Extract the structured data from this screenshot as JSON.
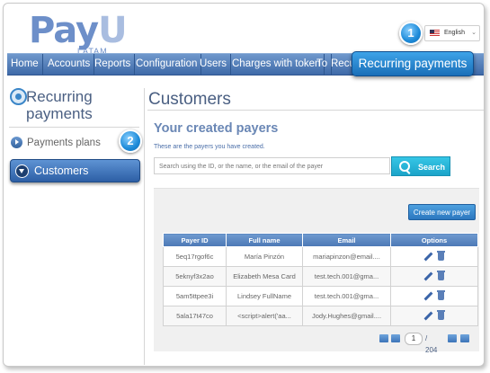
{
  "header": {
    "logo_main": "PayU",
    "logo_sub": "LATAM",
    "language": "English"
  },
  "nav": {
    "items": [
      "Home",
      "Accounts",
      "Reports",
      "Configuration",
      "Users",
      "Charges with token",
      "To",
      "Recu"
    ],
    "callout": "Recurring payments",
    "badge1": "1"
  },
  "sidebar": {
    "title_line1": "Recurring",
    "title_line2": "payments",
    "payments_plans": "Payments plans",
    "customers": "Customers",
    "badge2": "2"
  },
  "main": {
    "title": "Customers",
    "subtitle": "Your created payers",
    "description": "These are the payers you have created.",
    "search_placeholder": "Search using the ID, or the name, or the email of the payer",
    "search_button": "Search",
    "create_button": "Create new payer",
    "table": {
      "headers": [
        "Payer ID",
        "Full name",
        "Email",
        "Options"
      ],
      "rows": [
        [
          "5eq17rgof6c",
          "María Pinzón",
          "mariapinzon@email....",
          ""
        ],
        [
          "5eknyf3x2ao",
          "Elizabeth Mesa Card",
          "test.tech.001@gma...",
          ""
        ],
        [
          "5am5ttpee3i",
          "Lindsey FullName",
          "test.tech.001@gma...",
          ""
        ],
        [
          "5ala17t47co",
          "<script>alert('aa...",
          "Jody.Hughes@gmail....",
          ""
        ]
      ]
    },
    "pager": {
      "page": "1",
      "total": "/ 204"
    }
  },
  "colors": {
    "accent": "#3f6aa8",
    "callout": "#1a6fb8",
    "search": "#1ba4c9"
  }
}
